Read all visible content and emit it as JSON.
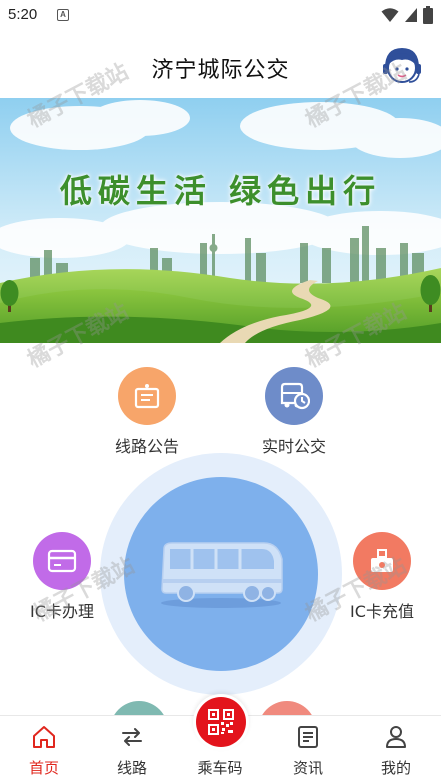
{
  "status_bar": {
    "time": "5:20",
    "notification_icon_letter": "A"
  },
  "header": {
    "title": "济宁城际公交"
  },
  "banner": {
    "slogan": "低碳生活 绿色出行"
  },
  "features": {
    "route_notice": {
      "label": "线路公告",
      "color": "#f7a56a"
    },
    "realtime_bus": {
      "label": "实时公交",
      "color": "#6e8cc9"
    },
    "ic_card_apply": {
      "label": "IC卡办理",
      "color": "#c16be8"
    },
    "ic_card_recharge": {
      "label": "IC卡充值",
      "color": "#f27a62"
    }
  },
  "watermark": "橘子下载站",
  "tabbar": {
    "tabs": [
      {
        "label": "首页",
        "active": true
      },
      {
        "label": "线路",
        "active": false
      },
      {
        "label": "乘车码",
        "active": false
      },
      {
        "label": "资讯",
        "active": false
      },
      {
        "label": "我的",
        "active": false
      }
    ]
  },
  "colors": {
    "accent": "#e0271e",
    "center_circle": "#7eb0ec",
    "center_ring": "#e4eefb"
  }
}
